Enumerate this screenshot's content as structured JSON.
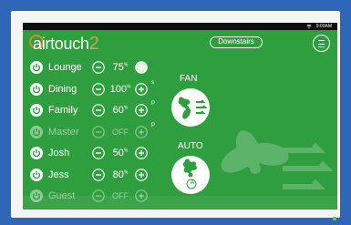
{
  "status_bar": {
    "time": "9:00AM"
  },
  "app": {
    "logo_text": "airtouch",
    "logo_number": "2"
  },
  "header": {
    "zone_group_label": "Downstairs"
  },
  "zones": [
    {
      "name": "Lounge",
      "value": "75",
      "unit": "%",
      "on": true,
      "spill": ""
    },
    {
      "name": "Dining",
      "value": "100",
      "unit": "%",
      "on": true,
      "spill": "s"
    },
    {
      "name": "Family",
      "value": "60",
      "unit": "%",
      "on": true,
      "spill": "P"
    },
    {
      "name": "Master",
      "value": "OFF",
      "unit": "",
      "on": false,
      "spill": "P"
    },
    {
      "name": "Josh",
      "value": "50",
      "unit": "%",
      "on": true,
      "spill": ""
    },
    {
      "name": "Jess",
      "value": "80",
      "unit": "%",
      "on": true,
      "spill": ""
    },
    {
      "name": "Guest",
      "value": "OFF",
      "unit": "",
      "on": false,
      "spill": ""
    }
  ],
  "modes": {
    "fan_label": "FAN",
    "auto_label": "AUTO",
    "auto_badge": "A"
  },
  "colors": {
    "screen_bg": "#2f9e3f",
    "logo_accent": "#d9a154",
    "outer_bg": "#2f67b8"
  }
}
